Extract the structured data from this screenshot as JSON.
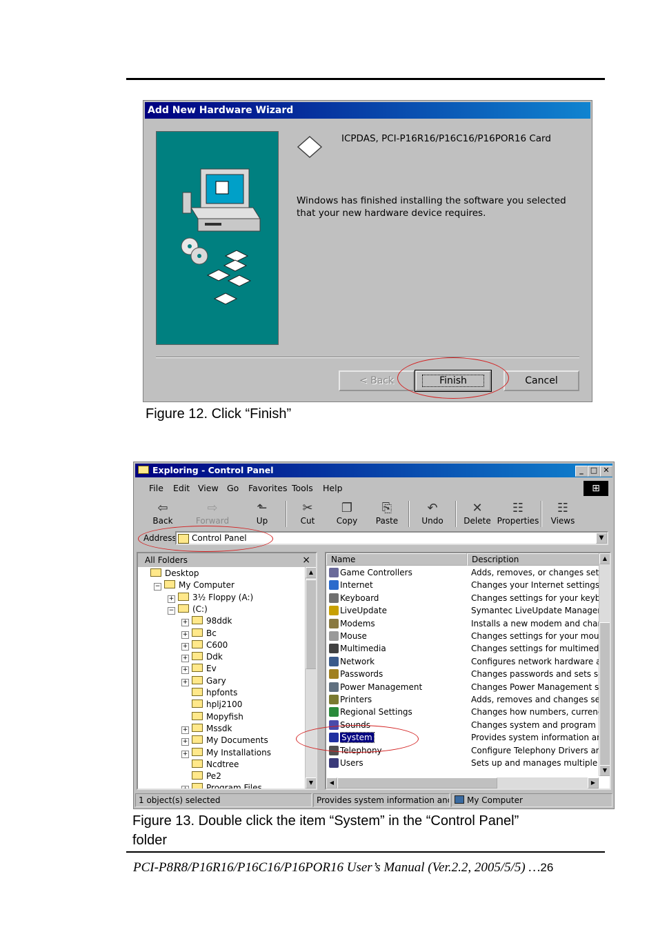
{
  "wizard": {
    "title": "Add New Hardware Wizard",
    "device_name": "ICPDAS, PCI-P16R16/P16C16/P16POR16 Card",
    "message": "Windows has finished installing the software you selected that your new hardware device requires.",
    "back_label": "< Back",
    "finish_label": "Finish",
    "cancel_label": "Cancel"
  },
  "figure12_caption": "Figure 12. Click “Finish”",
  "explorer": {
    "title": "Exploring - Control Panel",
    "menu": [
      "File",
      "Edit",
      "View",
      "Go",
      "Favorites",
      "Tools",
      "Help"
    ],
    "toolbar": [
      {
        "label": "Back",
        "icon": "back-arrow-icon",
        "glyph": "⇦"
      },
      {
        "label": "Forward",
        "icon": "forward-arrow-icon",
        "glyph": "⇨"
      },
      {
        "label": "Up",
        "icon": "up-folder-icon",
        "glyph": "⬑"
      },
      {
        "label": "Cut",
        "icon": "scissors-icon",
        "glyph": "✂"
      },
      {
        "label": "Copy",
        "icon": "copy-icon",
        "glyph": "❐"
      },
      {
        "label": "Paste",
        "icon": "paste-icon",
        "glyph": "⎘"
      },
      {
        "label": "Undo",
        "icon": "undo-icon",
        "glyph": "↶"
      },
      {
        "label": "Delete",
        "icon": "delete-x-icon",
        "glyph": "✕"
      },
      {
        "label": "Properties",
        "icon": "properties-icon",
        "glyph": "☷"
      },
      {
        "label": "Views",
        "icon": "views-icon",
        "glyph": "☷"
      }
    ],
    "address_label": "Address",
    "address_value": "Control Panel",
    "folders_header": "All Folders",
    "folders_close": "×",
    "tree": [
      {
        "label": "Desktop",
        "level": 0,
        "pm": ""
      },
      {
        "label": "My Computer",
        "level": 1,
        "pm": "−"
      },
      {
        "label": "3½ Floppy (A:)",
        "level": 2,
        "pm": "+"
      },
      {
        "label": "(C:)",
        "level": 2,
        "pm": "−"
      },
      {
        "label": "98ddk",
        "level": 3,
        "pm": "+"
      },
      {
        "label": "Bc",
        "level": 3,
        "pm": "+"
      },
      {
        "label": "C600",
        "level": 3,
        "pm": "+"
      },
      {
        "label": "Ddk",
        "level": 3,
        "pm": "+"
      },
      {
        "label": "Ev",
        "level": 3,
        "pm": "+"
      },
      {
        "label": "Gary",
        "level": 3,
        "pm": "+"
      },
      {
        "label": "hpfonts",
        "level": 3,
        "pm": ""
      },
      {
        "label": "hplj2100",
        "level": 3,
        "pm": ""
      },
      {
        "label": "Mopyfish",
        "level": 3,
        "pm": ""
      },
      {
        "label": "Mssdk",
        "level": 3,
        "pm": "+"
      },
      {
        "label": "My Documents",
        "level": 3,
        "pm": "+"
      },
      {
        "label": "My Installations",
        "level": 3,
        "pm": "+"
      },
      {
        "label": "Ncdtree",
        "level": 3,
        "pm": ""
      },
      {
        "label": "Pe2",
        "level": 3,
        "pm": ""
      },
      {
        "label": "Program Files",
        "level": 3,
        "pm": "+"
      }
    ],
    "columns": [
      "Name",
      "Description"
    ],
    "items": [
      {
        "name": "Game Controllers",
        "desc": "Adds, removes, or changes settings f",
        "color": "#6a6a9a"
      },
      {
        "name": "Internet",
        "desc": "Changes your Internet settings.",
        "color": "#2a6acc"
      },
      {
        "name": "Keyboard",
        "desc": "Changes settings for your keyboard.",
        "color": "#707070"
      },
      {
        "name": "LiveUpdate",
        "desc": "Symantec LiveUpdate Manager",
        "color": "#c8a000"
      },
      {
        "name": "Modems",
        "desc": "Installs a new modem and changes n",
        "color": "#8a7a40"
      },
      {
        "name": "Mouse",
        "desc": "Changes settings for your mouse.",
        "color": "#9a9a9a"
      },
      {
        "name": "Multimedia",
        "desc": "Changes settings for multimedia devic",
        "color": "#404040"
      },
      {
        "name": "Network",
        "desc": "Configures network hardware and so",
        "color": "#3a5a8a"
      },
      {
        "name": "Passwords",
        "desc": "Changes passwords and sets security",
        "color": "#a08020"
      },
      {
        "name": "Power Management",
        "desc": "Changes Power Management setting",
        "color": "#607080"
      },
      {
        "name": "Printers",
        "desc": "Adds, removes and changes settings",
        "color": "#7a7a30"
      },
      {
        "name": "Regional Settings",
        "desc": "Changes how numbers, currencies, c",
        "color": "#2a8a3a"
      },
      {
        "name": "Sounds",
        "desc": "Changes system and program sounds",
        "color": "#4a4aaa"
      },
      {
        "name": "System",
        "desc": "Provides system information and char",
        "color": "#2030a0"
      },
      {
        "name": "Telephony",
        "desc": "Configure Telephony Drivers and Dia",
        "color": "#505050"
      },
      {
        "name": "Users",
        "desc": "Sets up and manages multiple users",
        "color": "#3a3a7a"
      }
    ],
    "selected_index": 13,
    "status_left": "1 object(s) selected",
    "status_mid": "Provides system information and chang",
    "status_right": "My Computer"
  },
  "figure13_caption_line1": "Figure 13. Double click the item “System” in the “Control Panel”",
  "figure13_caption_line2": "folder",
  "footer_text": "PCI-P8R8/P16R16/P16C16/P16POR16 User’s Manual  (Ver.2.2, 2005/5/5)  …",
  "footer_page": "26"
}
